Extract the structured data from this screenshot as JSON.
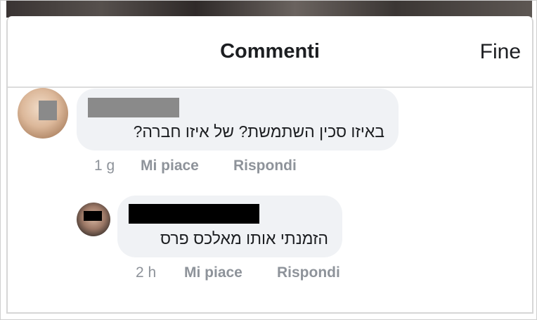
{
  "header": {
    "title": "Commenti",
    "done_label": "Fine"
  },
  "comments": [
    {
      "text": "באיזו סכין השתמשת? של איזו חברה?",
      "time": "1 g",
      "like_label": "Mi piace",
      "reply_label": "Rispondi"
    },
    {
      "text": "הזמנתי אותו מאלכס פרס",
      "time": "2 h",
      "like_label": "Mi piace",
      "reply_label": "Rispondi"
    }
  ],
  "colors": {
    "bubble": "#f0f2f5",
    "meta_text": "#8e939a",
    "primary_text": "#1c1e21",
    "redaction_gray": "#8a8a8a",
    "redaction_black": "#000000"
  }
}
